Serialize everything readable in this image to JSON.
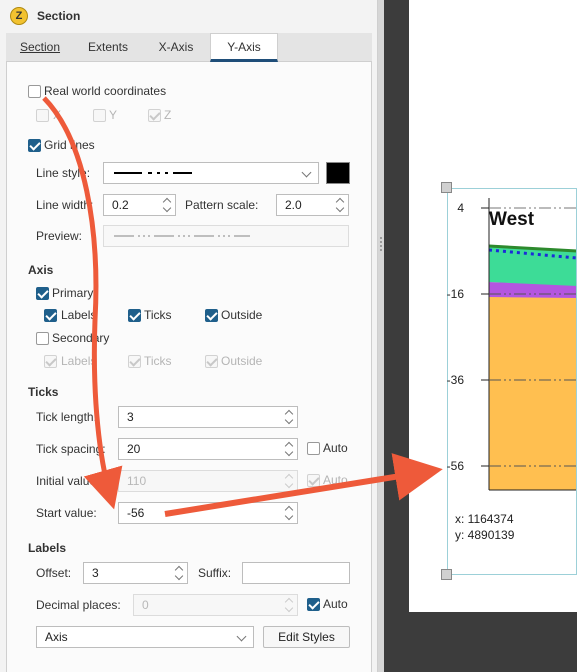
{
  "window": {
    "title": "Section",
    "icon_letter": "Z"
  },
  "tabs": [
    {
      "label": "Section"
    },
    {
      "label": "Extents"
    },
    {
      "label": "X-Axis"
    },
    {
      "label": "Y-Axis",
      "active": true
    }
  ],
  "real_world": {
    "label": "Real world coordinates",
    "checked": false,
    "x_label": "X",
    "y_label": "Y",
    "z_label": "Z"
  },
  "grid_lines": {
    "label": "Grid lines",
    "checked": true
  },
  "line_style": {
    "label": "Line style:",
    "color": "#000000"
  },
  "line_width": {
    "label": "Line width:",
    "value": "0.2"
  },
  "pattern_scale": {
    "label": "Pattern scale:",
    "value": "2.0"
  },
  "preview": {
    "label": "Preview:"
  },
  "axis": {
    "section_label": "Axis",
    "primary": {
      "label": "Primary",
      "checked": true,
      "labels": "Labels",
      "ticks": "Ticks",
      "outside": "Outside"
    },
    "secondary": {
      "label": "Secondary",
      "checked": false,
      "labels": "Labels",
      "ticks": "Ticks",
      "outside": "Outside"
    }
  },
  "ticks": {
    "section_label": "Ticks",
    "tick_length": {
      "label": "Tick length:",
      "value": "3"
    },
    "tick_spacing": {
      "label": "Tick spacing:",
      "value": "20",
      "auto_label": "Auto",
      "auto_checked": false
    },
    "initial_value": {
      "label": "Initial value:",
      "value": "110",
      "auto_label": "Auto"
    },
    "start_value": {
      "label": "Start value:",
      "value": "-56"
    }
  },
  "labels": {
    "section_label": "Labels",
    "offset": {
      "label": "Offset:",
      "value": "3"
    },
    "suffix": {
      "label": "Suffix:",
      "value": ""
    },
    "decimal_places": {
      "label": "Decimal places:",
      "value": "0",
      "auto_label": "Auto",
      "auto_checked": true
    },
    "font_select": "Axis",
    "edit_styles_button": "Edit Styles"
  },
  "section_view": {
    "title": "West",
    "y_ticks": [
      "4",
      "-16",
      "-36",
      "-56"
    ],
    "coord_x": "x: 1164374",
    "coord_y": "y: 4890139",
    "layer_colors": {
      "green": "#3ddc97",
      "blue_line": "#1c2bd8",
      "purple": "#b455e0",
      "orange": "#ffbf50",
      "top_line": "#2d8a2d"
    }
  },
  "annotations": {
    "arrow_color": "#ee5a3a"
  }
}
